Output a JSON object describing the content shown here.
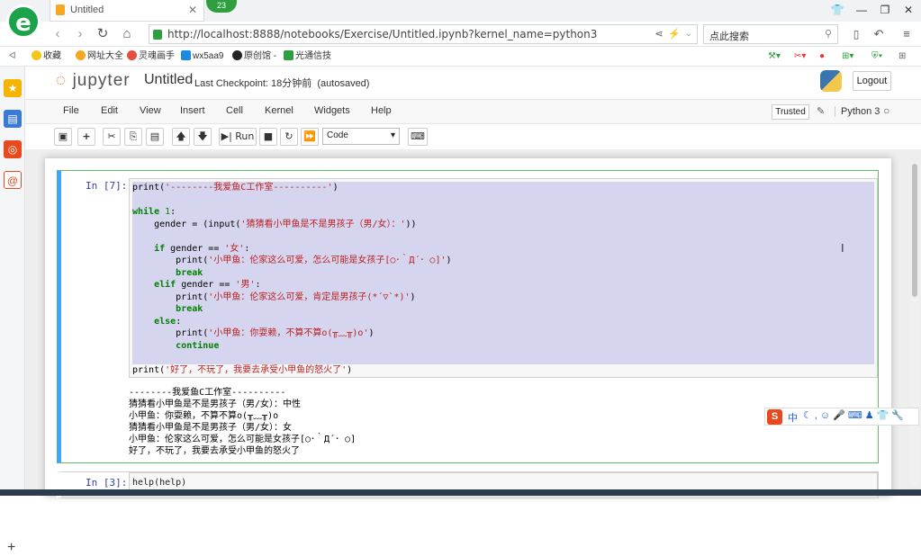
{
  "browser": {
    "tab_title": "Untitled",
    "badge": "23",
    "url": "http://localhost:8888/notebooks/Exercise/Untitled.ipynb?kernel_name=python3",
    "search_placeholder": "点此搜索",
    "bookmarks": [
      "收藏",
      "网址大全",
      "灵魂画手",
      "wx5aa9",
      "原创馆 -",
      "光通信技"
    ]
  },
  "jupyter": {
    "logo_text": "jupyter",
    "notebook_name": "Untitled",
    "checkpoint_label": "Last Checkpoint:",
    "checkpoint_time": "18分钟前",
    "autosave": "(autosaved)",
    "logout": "Logout",
    "menu": [
      "File",
      "Edit",
      "View",
      "Insert",
      "Cell",
      "Kernel",
      "Widgets",
      "Help"
    ],
    "trusted": "Trusted",
    "kernel": "Python 3",
    "toolbar": {
      "run": "Run",
      "cell_type": "Code"
    }
  },
  "cell1": {
    "prompt": "In [7]:",
    "code_lines": [
      "print('--------我爱鱼C工作室----------')",
      "",
      "while 1:",
      "    gender = (input('猜猜看小甲鱼是不是男孩子（男/女）：'))",
      "",
      "    if gender == '女':",
      "        print('小甲鱼：伦家这么可爱，怎么可能是女孩子[○･｀Д´･ ○]')",
      "        break",
      "    elif gender == '男':",
      "        print('小甲鱼：伦家这么可爱，肯定是男孩子(*´▽`*)')",
      "        break",
      "    else:",
      "        print('小甲鱼：你耍赖，不算不算o(╥﹏╥)o')",
      "        continue",
      "",
      "print('好了，不玩了，我要去承受小甲鱼的怒火了')"
    ],
    "output_lines": [
      "--------我爱鱼C工作室----------",
      "猜猜看小甲鱼是不是男孩子（男/女）：中性",
      "小甲鱼：你耍赖，不算不算o(╥﹏╥)o",
      "猜猜看小甲鱼是不是男孩子（男/女）：女",
      "小甲鱼：伦家这么可爱，怎么可能是女孩子[○･｀Д´･ ○]",
      "好了，不玩了，我要去承受小甲鱼的怒火了"
    ]
  },
  "cell2": {
    "prompt": "In [3]:",
    "code": "help(help)"
  },
  "ime": {
    "label": "中"
  }
}
